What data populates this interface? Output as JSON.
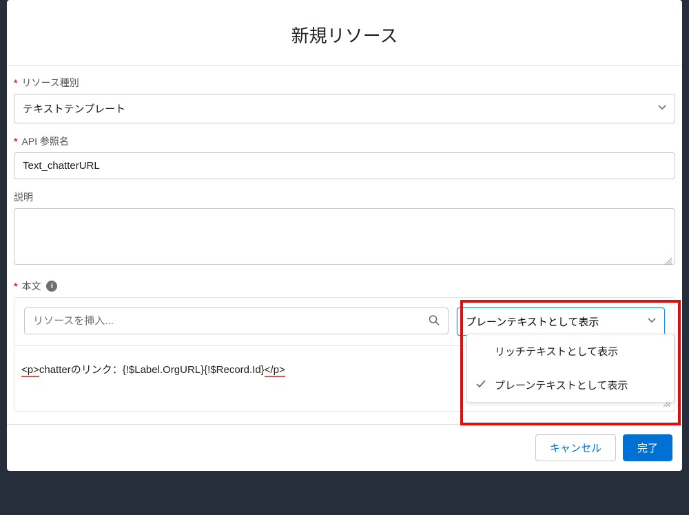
{
  "modal": {
    "title": "新規リソース"
  },
  "fields": {
    "resource_type": {
      "label": "リソース種別",
      "value": "テキストテンプレート"
    },
    "api_name": {
      "label": "API 参照名",
      "value": "Text_chatterURL"
    },
    "description": {
      "label": "説明",
      "value": ""
    },
    "body": {
      "label": "本文",
      "search_placeholder": "リソースを挿入...",
      "display_mode": "プレーンテキストとして表示",
      "dropdown_options": [
        {
          "label": "リッチテキストとして表示",
          "selected": false
        },
        {
          "label": "プレーンテキストとして表示",
          "selected": true
        }
      ],
      "content_before": "<p>",
      "content_mid": "chatterのリンク：{!$Label.OrgURL}{!$Record.Id}",
      "content_after": "</p>"
    }
  },
  "footer": {
    "cancel": "キャンセル",
    "done": "完了"
  },
  "icons": {
    "info": "i",
    "check": "✓"
  }
}
